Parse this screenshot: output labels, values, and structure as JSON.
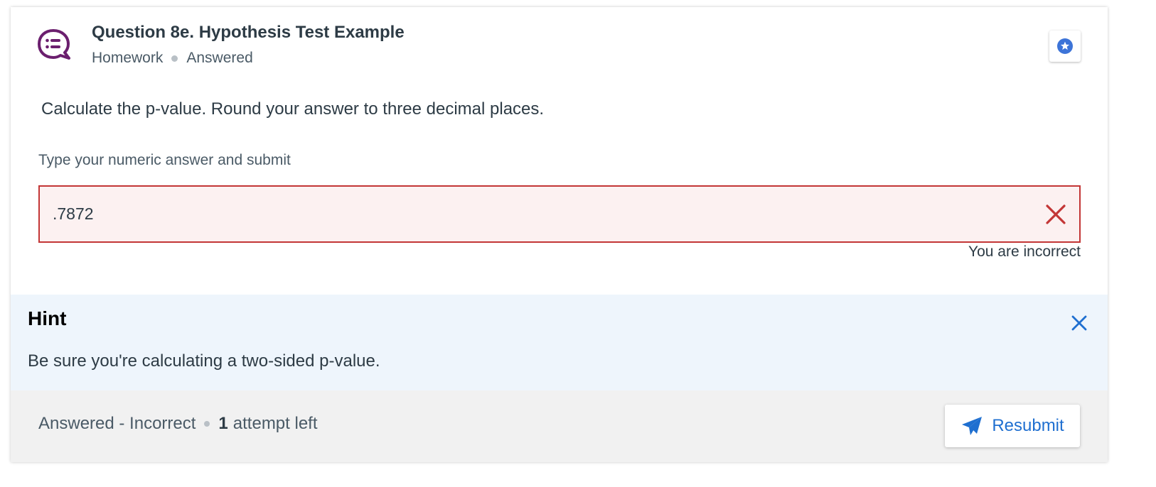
{
  "question": {
    "title": "Question 8e. Hypothesis Test Example",
    "type": "Homework",
    "state": "Answered",
    "icon": "question-chat-icon",
    "bookmark_icon": "star-badge-icon",
    "prompt": "Calculate the p-value. Round your answer to three decimal places."
  },
  "answer": {
    "label": "Type your numeric answer and submit",
    "value": ".7872",
    "feedback": "You are incorrect",
    "status_icon": "incorrect-x-icon"
  },
  "hint": {
    "title": "Hint",
    "body": "Be sure you're calculating a two-sided p-value.",
    "close_icon": "close-icon"
  },
  "footer": {
    "status": "Answered - Incorrect",
    "attempts_count": "1",
    "attempts_text": "attempt left",
    "resubmit_label": "Resubmit",
    "resubmit_icon": "paper-plane-icon"
  },
  "colors": {
    "accent_purple": "#6b1f6e",
    "error_red": "#c33636",
    "error_bg": "#fcf1f1",
    "hint_bg": "#eef5fc",
    "link_blue": "#1f6fd0",
    "footer_bg": "#f1f1f1"
  }
}
